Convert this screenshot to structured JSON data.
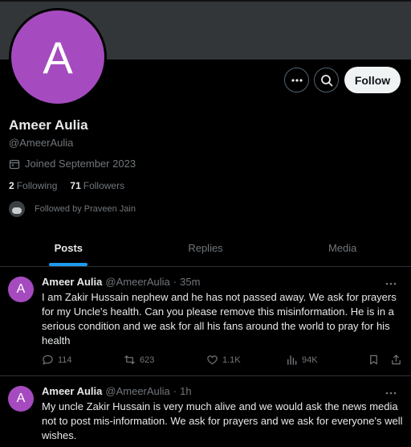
{
  "profile": {
    "avatar_letter": "A",
    "name": "Ameer Aulia",
    "handle": "@AmeerAulia",
    "joined": "Joined September 2023",
    "following_count": "2",
    "following_label": "Following",
    "followers_count": "71",
    "followers_label": "Followers",
    "followed_by": "Followed by Praveen Jain"
  },
  "header_actions": {
    "more_icon": "more-icon",
    "search_icon": "search-icon",
    "follow_label": "Follow"
  },
  "tabs": [
    {
      "label": "Posts",
      "active": true
    },
    {
      "label": "Replies",
      "active": false
    },
    {
      "label": "Media",
      "active": false
    }
  ],
  "tweets": [
    {
      "avatar_letter": "A",
      "name": "Ameer Aulia",
      "handle": "@AmeerAulia",
      "sep": "·",
      "time": "35m",
      "text": "I am Zakir Hussain nephew and he has not passed away. We ask for prayers for my Uncle's health. Can you please remove this misinformation. He is in a serious condition and we ask for all his fans around the world to pray for his health",
      "replies": "114",
      "reposts": "623",
      "likes": "1.1K",
      "views": "94K"
    },
    {
      "avatar_letter": "A",
      "name": "Ameer Aulia",
      "handle": "@AmeerAulia",
      "sep": "·",
      "time": "1h",
      "text": "My uncle Zakir Hussain is very much alive and we would ask the news media not to post mis-information. We ask for prayers and we ask for everyone's well wishes."
    }
  ],
  "colors": {
    "accent": "#1d9bf0",
    "avatar": "#a54bbf",
    "background": "#000000",
    "muted_text": "#71767b"
  }
}
